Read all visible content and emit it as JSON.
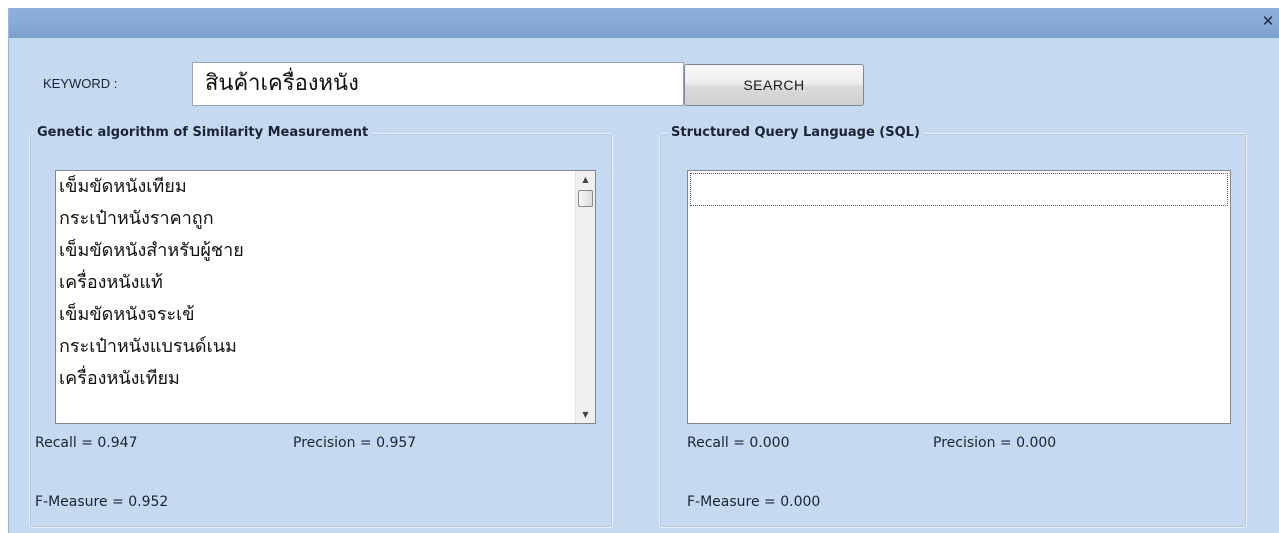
{
  "window": {
    "close_glyph": "✕"
  },
  "search": {
    "keyword_label": "KEYWORD :",
    "keyword_value": "สินค้าเครื่องหนัง",
    "search_button": "SEARCH"
  },
  "ga_panel": {
    "title": "Genetic algorithm of Similarity Measurement",
    "results": [
      "เข็มขัดหนังเทียม",
      "กระเป๋าหนังราคาถูก",
      "เข็มขัดหนังสำหรับผู้ชาย",
      "เครื่องหนังแท้",
      "เข็มขัดหนังจระเข้",
      "กระเป๋าหนังแบรนด์เนม",
      "เครื่องหนังเทียม"
    ],
    "recall": "Recall = 0.947",
    "precision": "Precision = 0.957",
    "f_measure": "F-Measure = 0.952"
  },
  "sql_panel": {
    "title": "Structured Query Language (SQL)",
    "results": [],
    "recall": "Recall = 0.000",
    "precision": "Precision = 0.000",
    "f_measure": "F-Measure = 0.000"
  }
}
